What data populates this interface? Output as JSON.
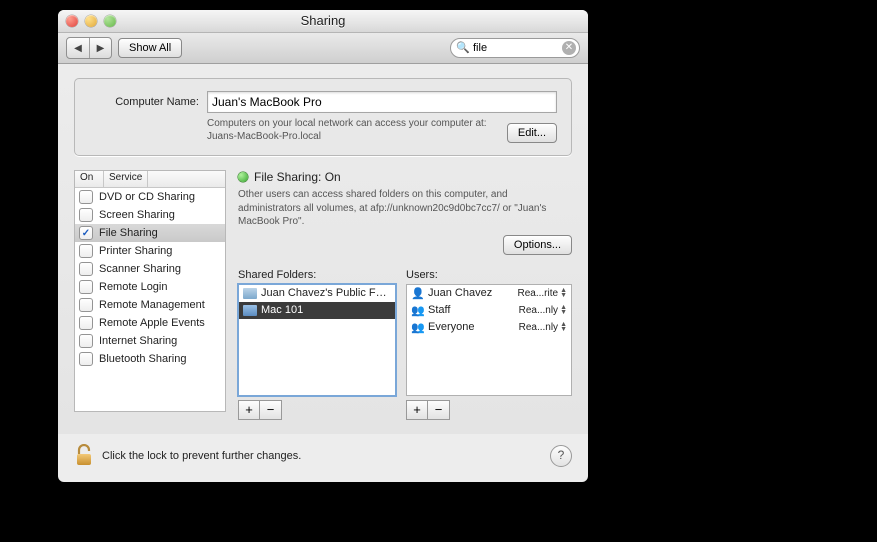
{
  "window": {
    "title": "Sharing"
  },
  "toolbar": {
    "back_aria": "Back",
    "forward_aria": "Forward",
    "show_all": "Show All",
    "search_value": "file",
    "search_placeholder": ""
  },
  "computer_name": {
    "label": "Computer Name:",
    "value": "Juan's MacBook Pro",
    "sub": "Computers on your local network can access your computer at: Juans-MacBook-Pro.local",
    "edit": "Edit..."
  },
  "service_headers": {
    "on": "On",
    "service": "Service"
  },
  "services": [
    {
      "checked": false,
      "label": "DVD or CD Sharing"
    },
    {
      "checked": false,
      "label": "Screen Sharing"
    },
    {
      "checked": true,
      "label": "File Sharing",
      "selected": true
    },
    {
      "checked": false,
      "label": "Printer Sharing"
    },
    {
      "checked": false,
      "label": "Scanner Sharing"
    },
    {
      "checked": false,
      "label": "Remote Login"
    },
    {
      "checked": false,
      "label": "Remote Management"
    },
    {
      "checked": false,
      "label": "Remote Apple Events"
    },
    {
      "checked": false,
      "label": "Internet Sharing"
    },
    {
      "checked": false,
      "label": "Bluetooth Sharing"
    }
  ],
  "file_sharing": {
    "status": "File Sharing: On",
    "desc": "Other users can access shared folders on this computer, and administrators all volumes, at afp://unknown20c9d0bc7cc7/ or \"Juan's MacBook Pro\".",
    "options": "Options..."
  },
  "folders": {
    "caption": "Shared Folders:",
    "items": [
      {
        "icon": "pub",
        "label": "Juan Chavez's Public Folder",
        "selected": false
      },
      {
        "icon": "fold",
        "label": "Mac 101",
        "selected": true
      }
    ],
    "add": "+",
    "remove": "−"
  },
  "users": {
    "caption": "Users:",
    "items": [
      {
        "icon": "single",
        "label": "Juan Chavez",
        "perm": "Rea...rite"
      },
      {
        "icon": "multi",
        "label": "Staff",
        "perm": "Rea...nly"
      },
      {
        "icon": "multi",
        "label": "Everyone",
        "perm": "Rea...nly"
      }
    ],
    "add": "+",
    "remove": "−"
  },
  "footer": {
    "lock_text": "Click the lock to prevent further changes.",
    "help": "?"
  }
}
